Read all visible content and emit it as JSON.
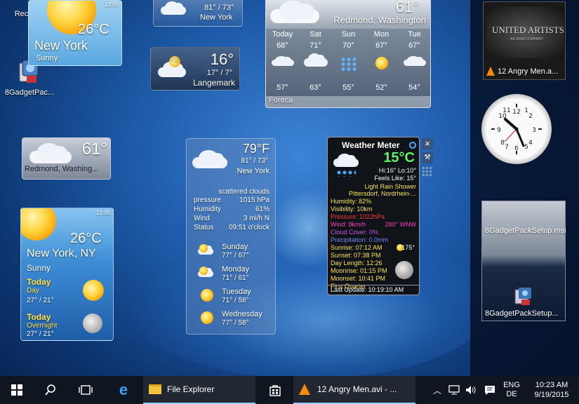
{
  "desktop": {
    "icons": [
      {
        "label": "Recyc"
      },
      {
        "label": "8GadgetPac..."
      }
    ]
  },
  "ny_gadget": {
    "temp": "26°C",
    "city": "New York",
    "cond": "Sunny",
    "time": "13:05"
  },
  "small_top": {
    "range": "81° / 73°",
    "city": "New York"
  },
  "langemark": {
    "temp": "16°",
    "range": "17° / 7°",
    "city": "Langemark"
  },
  "forecast": {
    "temp": "61°",
    "city": "Redmond, Washington",
    "provider": "Foreca",
    "days": [
      {
        "name": "Today",
        "high": "68°",
        "low": "57°"
      },
      {
        "name": "Sat",
        "high": "71°",
        "low": "63°"
      },
      {
        "name": "Sun",
        "high": "70°",
        "low": "55°"
      },
      {
        "name": "Mon",
        "high": "67°",
        "low": "52°"
      },
      {
        "name": "Tue",
        "high": "67°",
        "low": "54°"
      }
    ]
  },
  "redmond_small": {
    "temp": "61°",
    "city": "Redmond, Washing..."
  },
  "ny_large": {
    "time": "13:05",
    "temp": "26°C",
    "city": "New York, NY",
    "cond": "Sunny",
    "today_day": {
      "title": "Today",
      "sub": "Day",
      "range": "27° / 21°"
    },
    "today_night": {
      "title": "Today",
      "sub": "Overnight",
      "range": "27° / 21°"
    }
  },
  "mid_gadget": {
    "temp": "79°F",
    "range": "81° / 73°",
    "city": "New York",
    "cond": "scattered clouds",
    "details": [
      {
        "k": "pressure",
        "v": "1015 hPa"
      },
      {
        "k": "Humidity",
        "v": "61%"
      },
      {
        "k": "Wind",
        "v": "3 mi/h N"
      },
      {
        "k": "Status",
        "v": "09:51 o'clock"
      }
    ],
    "forecast": [
      {
        "day": "Sunday",
        "range": "77° / 67°"
      },
      {
        "day": "Monday",
        "range": "71° / 61°"
      },
      {
        "day": "Tuesday",
        "range": "71° / 58°"
      },
      {
        "day": "Wednesday",
        "range": "77° / 58°"
      }
    ]
  },
  "meter": {
    "title": "Weather Meter",
    "temp": "15°C",
    "hilo": "Hi:16° Lo:10°",
    "feels": "Feels Like: 15°",
    "cond": "Light Rain Shower",
    "place": "Pittersdorf, Nordrhein-...",
    "humidity": "Humidity: 82%",
    "visibility": "Visibility: 10km",
    "pressure": "Pressure: 1022hPa",
    "wind": "Wind: 8km/h",
    "wind_dir": "280° WNW",
    "cloud": "Cloud Cover: 0%",
    "precip": "Precipitation: 0.0mm",
    "sunrise": "Sunrise: 07:12 AM",
    "sunset": "Sunset: 07:38 PM",
    "daylen": "Day Length: 12:26",
    "moonrise": "Moonrise: 01:15 PM",
    "moonset": "Moonset: 10:41 PM",
    "phase": "First Quarter",
    "angle": "175°",
    "update": "Last Update: 10:19:10 AM"
  },
  "sidebar": {
    "ua_title": "UNITED ARTISTS",
    "ua_sub": "AN MGM COMPANY",
    "video": "12 Angry Men.a...",
    "file1": "8GadgetPackSetup.msi",
    "file2": "8GadgetPackSetup..."
  },
  "taskbar": {
    "explorer": "File Explorer",
    "vlc": "12 Angry Men.avi - ...",
    "lang1": "ENG",
    "lang2": "DE",
    "time": "10:23 AM",
    "date": "9/19/2015"
  }
}
